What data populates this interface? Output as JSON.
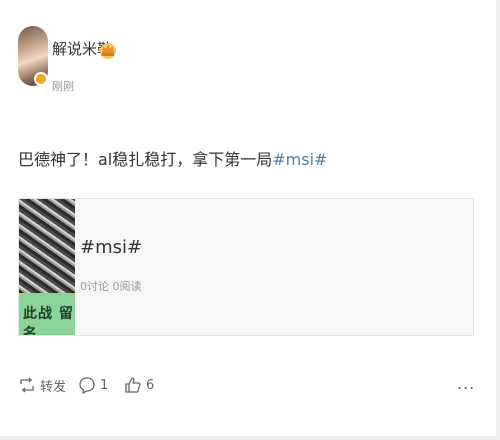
{
  "post": {
    "author": {
      "name": "解说米勒",
      "vip_icon": "crown-badge-icon",
      "avatar_badge_color": "#f5a623"
    },
    "time": "刚刚",
    "text": {
      "body": "巴德神了！al稳扎稳打，拿下第一局",
      "hashtag": "#msi#",
      "hashtag_color": "#507daf"
    },
    "card": {
      "thumb_label": "此战 留名",
      "title": "#msi#",
      "stats": "0讨论 0阅读"
    },
    "actions": {
      "repost_label": "转发",
      "comment_count": "1",
      "like_count": "6",
      "more_label": "..."
    }
  }
}
